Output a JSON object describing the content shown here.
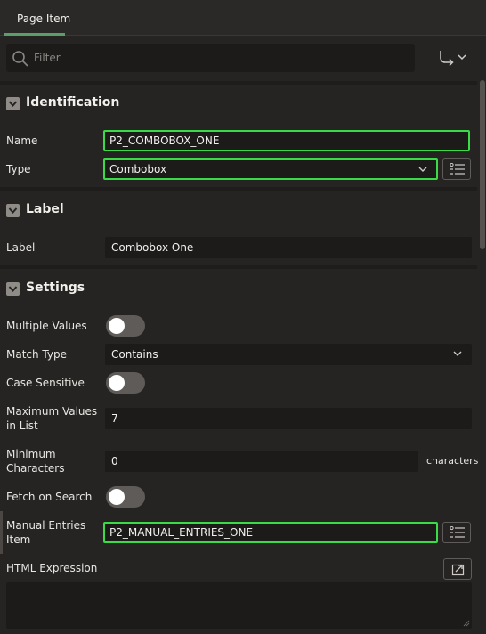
{
  "tabs": {
    "active": "Page Item"
  },
  "filter": {
    "placeholder": "Filter"
  },
  "sections": {
    "identification": {
      "title": "Identification",
      "name_label": "Name",
      "name_value": "P2_COMBOBOX_ONE",
      "type_label": "Type",
      "type_value": "Combobox"
    },
    "label": {
      "title": "Label",
      "label_label": "Label",
      "label_value": "Combobox One"
    },
    "settings": {
      "title": "Settings",
      "multiple_values_label": "Multiple Values",
      "multiple_values_on": false,
      "match_type_label": "Match Type",
      "match_type_value": "Contains",
      "case_sensitive_label": "Case Sensitive",
      "case_sensitive_on": false,
      "max_values_label_1": "Maximum Values",
      "max_values_label_2": "in List",
      "max_values_value": "7",
      "min_chars_label_1": "Minimum",
      "min_chars_label_2": "Characters",
      "min_chars_value": "0",
      "min_chars_suffix": "characters",
      "fetch_on_search_label": "Fetch on Search",
      "fetch_on_search_on": false,
      "manual_entries_label_1": "Manual Entries",
      "manual_entries_label_2": "Item",
      "manual_entries_value": "P2_MANUAL_ENTRIES_ONE",
      "html_expression_label": "HTML Expression",
      "html_expression_value": ""
    }
  },
  "colors": {
    "highlight": "#3adb46",
    "tab_underline": "#5c9e6a",
    "background": "#262422",
    "field": "#1c1b1a"
  },
  "icons": {
    "search": "search-icon",
    "goto": "goto-group-icon",
    "collapse": "chevron-down-icon",
    "select_caret": "chevron-down-icon",
    "list_of_values": "list-icon",
    "expand": "open-in-editor-icon"
  }
}
